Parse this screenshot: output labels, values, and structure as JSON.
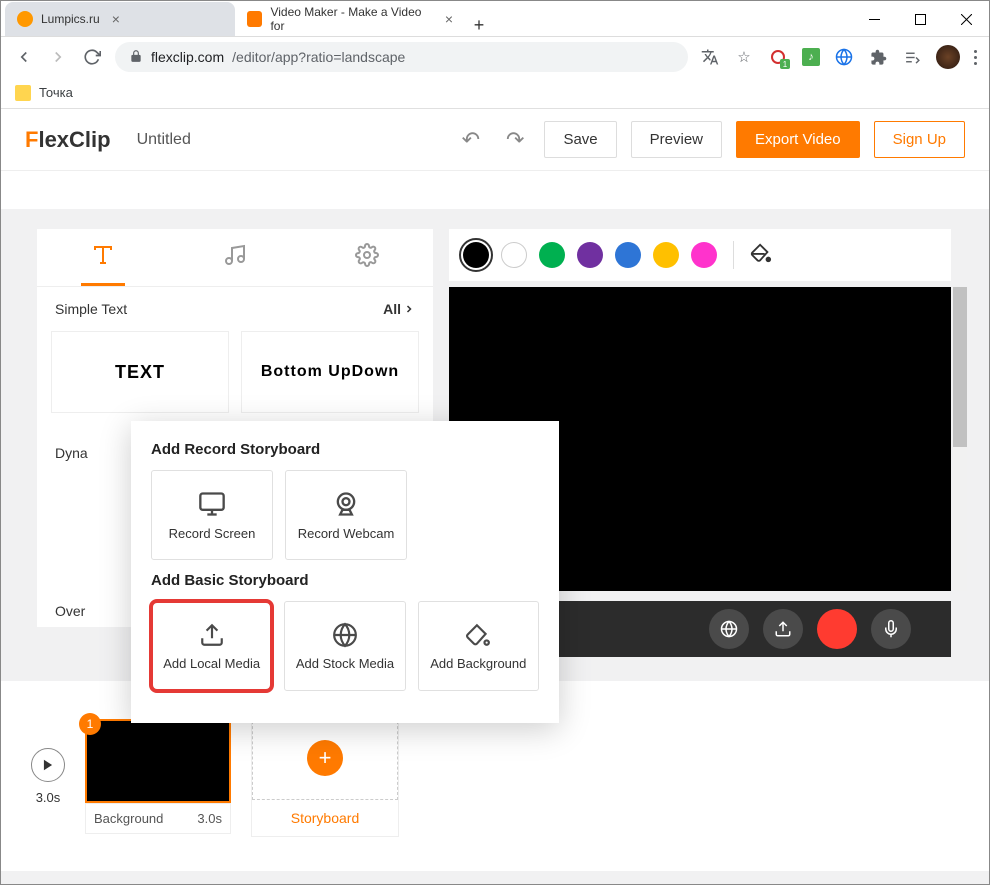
{
  "window": {
    "tabs": [
      {
        "title": "Lumpics.ru",
        "active": false
      },
      {
        "title": "Video Maker - Make a Video for",
        "active": true
      }
    ]
  },
  "browser": {
    "url_host": "flexclip.com",
    "url_path": "/editor/app?ratio=landscape",
    "bookmark": "Точка"
  },
  "app": {
    "logo_f": "F",
    "logo_rest": "lexClip",
    "project_name": "Untitled",
    "undo": "↶",
    "redo": "↷",
    "save": "Save",
    "preview": "Preview",
    "export": "Export Video",
    "signup": "Sign Up"
  },
  "panel": {
    "simple_text": "Simple Text",
    "all": "All",
    "card1": "TEXT",
    "card2_l1": "Bottom Up",
    "card2_l2": "Down",
    "dyna": "Dyna",
    "over": "Over"
  },
  "colors": [
    "#000000",
    "#ffffff",
    "#00b050",
    "#7030a0",
    "#2e75d6",
    "#ffc000",
    "#ff33cc"
  ],
  "popup": {
    "h1": "Add Record Storyboard",
    "record_screen": "Record Screen",
    "record_webcam": "Record Webcam",
    "h2": "Add Basic Storyboard",
    "add_local": "Add Local Media",
    "add_stock": "Add Stock Media",
    "add_bg": "Add Background"
  },
  "timeline": {
    "total": "3.0s",
    "clip_badge": "1",
    "clip_name": "Background",
    "clip_dur": "3.0s",
    "storyboard": "Storyboard"
  }
}
